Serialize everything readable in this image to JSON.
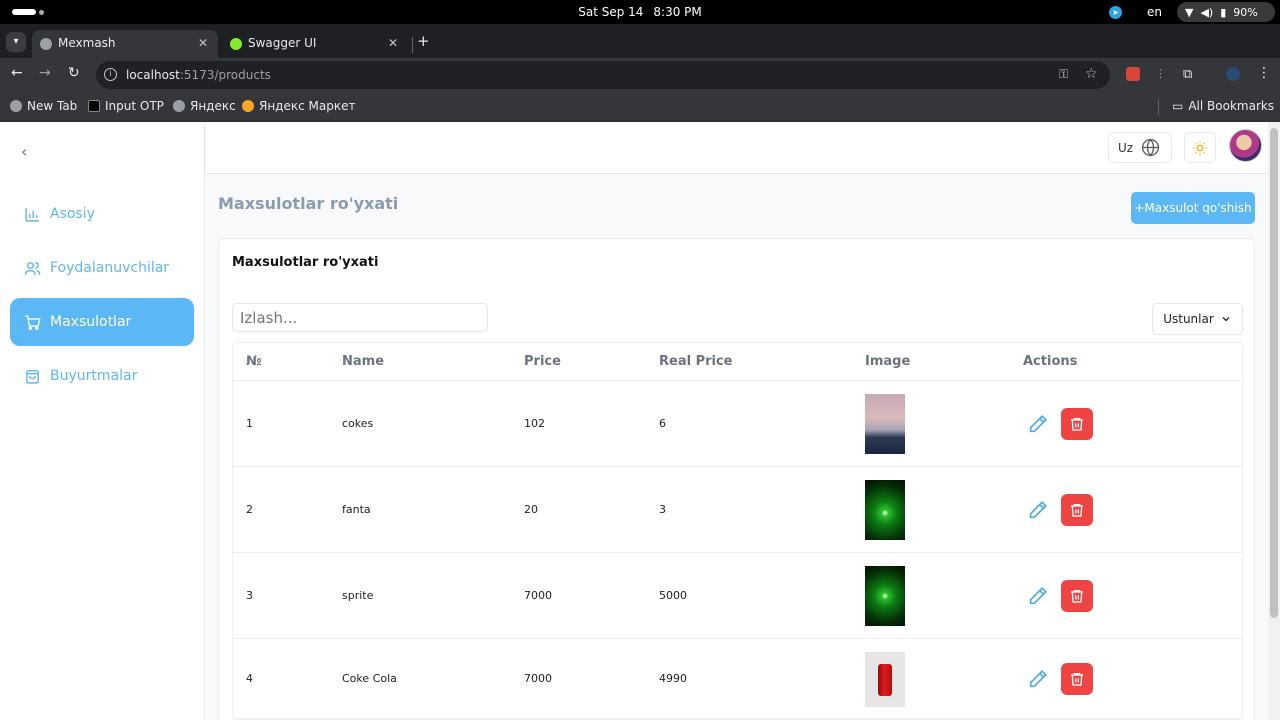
{
  "system": {
    "date": "Sat Sep 14",
    "time": "8:30 PM",
    "keyboard_lang": "en",
    "battery": "90%"
  },
  "browser": {
    "tabs": [
      {
        "title": "Mexmash",
        "active": true
      },
      {
        "title": "Swagger UI",
        "active": false
      }
    ],
    "url_host": "localhost",
    "url_path": ":5173/products",
    "bookmarks": [
      "New Tab",
      "Input OTP",
      "Яндекс",
      "Яндекс Маркет"
    ],
    "all_bookmarks": "All Bookmarks"
  },
  "sidebar": {
    "items": [
      {
        "label": "Asosiy",
        "icon": "bar-chart-icon",
        "active": false
      },
      {
        "label": "Foydalanuvchilar",
        "icon": "users-icon",
        "active": false
      },
      {
        "label": "Maxsulotlar",
        "icon": "cart-icon",
        "active": true
      },
      {
        "label": "Buyurtmalar",
        "icon": "shopping-bag-icon",
        "active": false
      }
    ]
  },
  "header": {
    "lang": "Uz"
  },
  "main": {
    "page_title": "Maxsulotlar ro'yxati",
    "add_button": "+Maxsulot qo'shish",
    "card_title": "Maxsulotlar ro'yxati",
    "search_placeholder": "Izlash...",
    "columns_button": "Ustunlar"
  },
  "table": {
    "headers": [
      "№",
      "Name",
      "Price",
      "Real Price",
      "Image",
      "Actions"
    ],
    "rows": [
      {
        "no": "1",
        "name": "cokes",
        "price": "102",
        "real_price": "6",
        "image": "sunset-mountains"
      },
      {
        "no": "2",
        "name": "fanta",
        "price": "20",
        "real_price": "3",
        "image": "green-leaf-drop"
      },
      {
        "no": "3",
        "name": "sprite",
        "price": "7000",
        "real_price": "5000",
        "image": "green-leaf-drop"
      },
      {
        "no": "4",
        "name": "Coke Cola",
        "price": "7000",
        "real_price": "4990",
        "image": "coca-cola-can"
      }
    ]
  },
  "colors": {
    "accent": "#5cb8f5",
    "danger": "#ef4444",
    "title_gray": "#8a9bb0"
  }
}
